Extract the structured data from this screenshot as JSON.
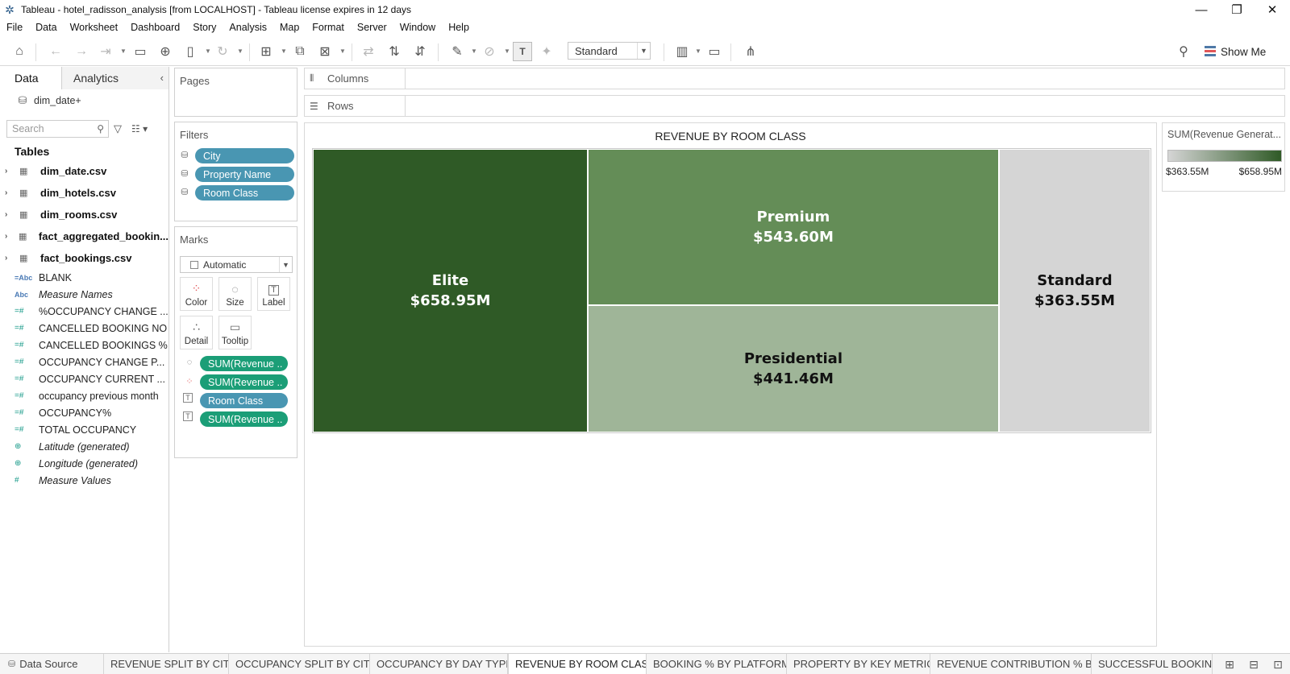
{
  "window": {
    "title": "Tableau - hotel_radisson_analysis [from LOCALHOST] - Tableau license expires in 12 days"
  },
  "menu": [
    "File",
    "Data",
    "Worksheet",
    "Dashboard",
    "Story",
    "Analysis",
    "Map",
    "Format",
    "Server",
    "Window",
    "Help"
  ],
  "toolbar": {
    "fit": "Standard",
    "show_me": "Show Me"
  },
  "data_pane": {
    "tabs": [
      "Data",
      "Analytics"
    ],
    "datasource": "dim_date+",
    "search_placeholder": "Search",
    "tables_heading": "Tables",
    "tables": [
      "dim_date.csv",
      "dim_hotels.csv",
      "dim_rooms.csv",
      "fact_aggregated_bookin...",
      "fact_bookings.csv"
    ],
    "fields": [
      {
        "label": "BLANK",
        "icon": "=Abc",
        "italic": false
      },
      {
        "label": "Measure Names",
        "icon": "Abc",
        "italic": true
      },
      {
        "label": "%OCCUPANCY CHANGE ...",
        "icon": "=#",
        "italic": false
      },
      {
        "label": "CANCELLED BOOKING NO",
        "icon": "=#",
        "italic": false
      },
      {
        "label": "CANCELLED BOOKINGS %",
        "icon": "=#",
        "italic": false
      },
      {
        "label": "OCCUPANCY CHANGE P...",
        "icon": "=#",
        "italic": false
      },
      {
        "label": "OCCUPANCY CURRENT ...",
        "icon": "=#",
        "italic": false
      },
      {
        "label": "occupancy previous month",
        "icon": "=#",
        "italic": false
      },
      {
        "label": "OCCUPANCY%",
        "icon": "=#",
        "italic": false
      },
      {
        "label": "TOTAL OCCUPANCY",
        "icon": "=#",
        "italic": false
      },
      {
        "label": "Latitude (generated)",
        "icon": "globe",
        "italic": true
      },
      {
        "label": "Longitude (generated)",
        "icon": "globe",
        "italic": true
      },
      {
        "label": "Measure Values",
        "icon": "#",
        "italic": true
      }
    ]
  },
  "pages": {
    "title": "Pages"
  },
  "filters": {
    "title": "Filters",
    "pills": [
      "City",
      "Property Name",
      "Room Class"
    ]
  },
  "marks": {
    "title": "Marks",
    "type": "Automatic",
    "buttons": [
      "Color",
      "Size",
      "Label",
      "Detail",
      "Tooltip"
    ],
    "pills": [
      {
        "label": "SUM(Revenue ..",
        "icon": "size",
        "color": "green"
      },
      {
        "label": "SUM(Revenue ..",
        "icon": "color",
        "color": "green"
      },
      {
        "label": "Room Class",
        "icon": "label",
        "color": "blue"
      },
      {
        "label": "SUM(Revenue ..",
        "icon": "label",
        "color": "green"
      }
    ]
  },
  "shelves": {
    "columns": "Columns",
    "rows": "Rows"
  },
  "viz": {
    "title": "REVENUE BY ROOM CLASS"
  },
  "chart_data": {
    "type": "treemap",
    "title": "REVENUE BY ROOM CLASS",
    "measure": "SUM(Revenue Generat...",
    "unit": "$M",
    "items": [
      {
        "name": "Elite",
        "value": 658.95,
        "label": "$658.95M",
        "color": "#2f5a26",
        "text_color": "#ffffff"
      },
      {
        "name": "Premium",
        "value": 543.6,
        "label": "$543.60M",
        "color": "#648d57",
        "text_color": "#ffffff"
      },
      {
        "name": "Presidential",
        "value": 441.46,
        "label": "$441.46M",
        "color": "#9fb598",
        "text_color": "#111111"
      },
      {
        "name": "Standard",
        "value": 363.55,
        "label": "$363.55M",
        "color": "#d5d5d5",
        "text_color": "#111111"
      }
    ],
    "color_range": {
      "min": 363.55,
      "max": 658.95,
      "min_color": "#d5d5d5",
      "max_color": "#2f5a26"
    }
  },
  "legend": {
    "title": "SUM(Revenue Generat...",
    "min_label": "$363.55M",
    "max_label": "$658.95M"
  },
  "sheet_tabs": {
    "datasource": "Data Source",
    "tabs": [
      "REVENUE SPLIT BY CITY",
      "OCCUPANCY SPLIT BY CITY",
      "OCCUPANCY BY DAY TYPE",
      "REVENUE BY ROOM CLASS",
      "BOOKING % BY PLATFORM",
      "PROPERTY BY KEY METRICS",
      "REVENUE CONTRIBUTION % B...",
      "SUCCESSFUL BOOKING"
    ],
    "active": "REVENUE BY ROOM CLASS"
  }
}
